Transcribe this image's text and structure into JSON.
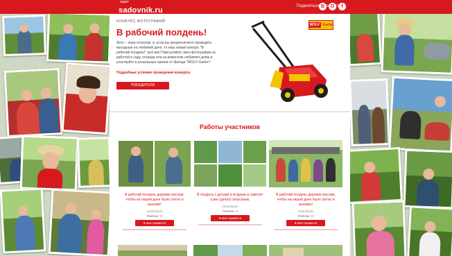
{
  "header": {
    "logo_small": "super",
    "logo_main": "sadovnik.ru",
    "share_label": "Поделиться в соцсетях:",
    "social": [
      {
        "icon": "vk-icon",
        "glyph": "B"
      },
      {
        "icon": "ok-icon",
        "glyph": "O"
      },
      {
        "icon": "facebook-icon",
        "glyph": "f"
      }
    ]
  },
  "hero": {
    "subtitle": "КОНКУРС ФОТОГРАФИЙ",
    "title": "В рабочий полдень!",
    "text": "Лето – пора отпусков, и, если вы предпочитаете проводить выходные на любимой даче, то наш новый конкурс \"В рабочий полдень!\" для вас! Присылайте свои фотографии за работой в саду, огороде или за ремонтом любимого дома и участвуйте в розыгрыше призов от бренда \"WOLF-Garten\".",
    "rules_link": "Подробные условия проведения конкурса",
    "winners_button": "ПОБЕДИТЕЛИ",
    "brand_badge_word": "WOLF",
    "brand_badge_sub": "Garten"
  },
  "works": {
    "title": "Работы участников",
    "cards": [
      {
        "caption": "В рабочий полдень дорожки мостим, чтобы на нашей даче было уютно и красиво!",
        "author": "veranzhyrin",
        "rating": "Рейтинг: 0",
        "like": "мне нравится"
      },
      {
        "caption": "В полдень с детьми в ягодные и самолёт (сам сделал) запускаем.",
        "author": "veranzhyrin",
        "rating": "Рейтинг: 0",
        "like": "мне нравится"
      },
      {
        "caption": "В рабочий полдень дорожки мостим, чтобы на нашей даче было уютно и красиво!",
        "author": "veranzhyrin",
        "rating": "Рейтинг: 0",
        "like": "мне нравится"
      }
    ]
  },
  "colors": {
    "brand_red": "#d7191e",
    "wolf_yellow": "#f5c400"
  }
}
